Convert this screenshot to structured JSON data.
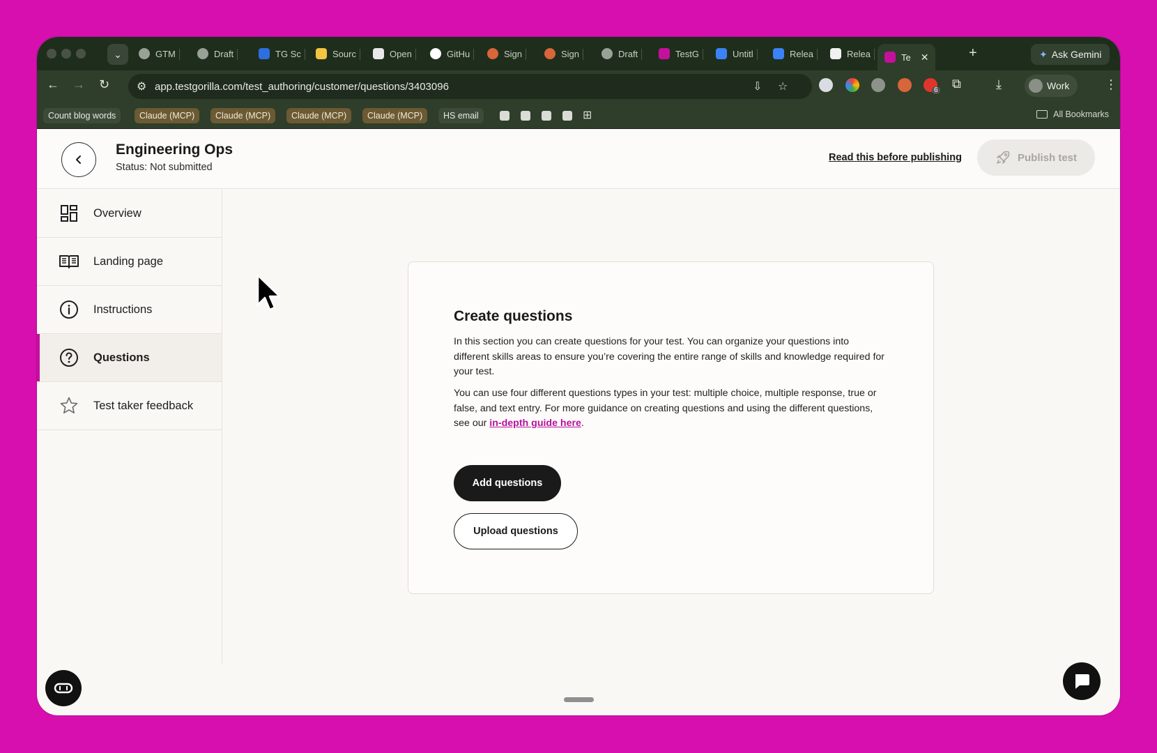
{
  "browser": {
    "tabs": [
      {
        "label": "GTM"
      },
      {
        "label": "Draft"
      },
      {
        "label": "TG Sc"
      },
      {
        "label": "Sourc"
      },
      {
        "label": "Open"
      },
      {
        "label": "GitHu"
      },
      {
        "label": "Sign"
      },
      {
        "label": "Sign"
      },
      {
        "label": "Draft"
      },
      {
        "label": "TestG"
      },
      {
        "label": "Untitl"
      },
      {
        "label": "Relea"
      },
      {
        "label": "Relea"
      },
      {
        "label": "Te",
        "active": true
      }
    ],
    "ask_gemini": "Ask Gemini",
    "url": "app.testgorilla.com/test_authoring/customer/questions/3403096",
    "profile": "Work",
    "extension_badge": "6",
    "bookmarks": [
      "Count blog words",
      "Claude (MCP)",
      "Claude (MCP)",
      "Claude (MCP)",
      "Claude (MCP)",
      "HS email"
    ],
    "all_bookmarks": "All Bookmarks"
  },
  "header": {
    "title": "Engineering Ops",
    "status": "Status: Not submitted",
    "read_link": "Read this before publishing",
    "publish": "Publish test"
  },
  "sidebar": {
    "items": [
      {
        "label": "Overview",
        "icon": "dashboard-icon"
      },
      {
        "label": "Landing page",
        "icon": "book-icon"
      },
      {
        "label": "Instructions",
        "icon": "info-icon"
      },
      {
        "label": "Questions",
        "icon": "question-circle-icon",
        "active": true
      },
      {
        "label": "Test taker feedback",
        "icon": "star-icon"
      }
    ]
  },
  "card": {
    "title": "Create questions",
    "p1": "In this section you can create questions for your test. You can organize your questions into different skills areas to ensure you’re covering the entire range of skills and knowledge required for your test.",
    "p2_before": "You can use four different questions types in your test: multiple choice, multiple response, true or false, and text entry. For more guidance on creating questions and using the different questions, see our ",
    "p2_link": "in-depth guide here",
    "p2_after": ".",
    "add_btn": "Add questions",
    "upload_btn": "Upload questions"
  },
  "colors": {
    "accent": "#c5109c",
    "background": "#d60fae",
    "browser_chrome": "#2f3d2b"
  }
}
